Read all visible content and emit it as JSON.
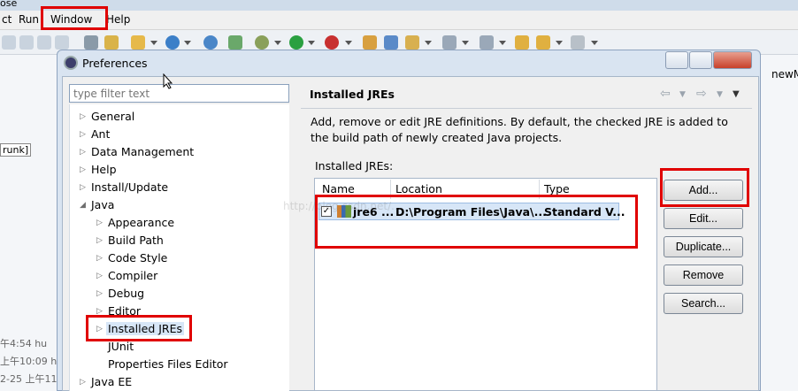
{
  "app": {
    "title_fragment": "ose",
    "menu": [
      "ct",
      "Run",
      "Window",
      "Help"
    ]
  },
  "dialog": {
    "title": "Preferences",
    "filter_placeholder": "type filter text",
    "tree": [
      {
        "label": "General",
        "level": 0,
        "expanded": false
      },
      {
        "label": "Ant",
        "level": 0,
        "expanded": false
      },
      {
        "label": "Data Management",
        "level": 0,
        "expanded": false
      },
      {
        "label": "Help",
        "level": 0,
        "expanded": false
      },
      {
        "label": "Install/Update",
        "level": 0,
        "expanded": false
      },
      {
        "label": "Java",
        "level": 0,
        "expanded": true
      },
      {
        "label": "Appearance",
        "level": 1,
        "expanded": false
      },
      {
        "label": "Build Path",
        "level": 1,
        "expanded": false
      },
      {
        "label": "Code Style",
        "level": 1,
        "expanded": false
      },
      {
        "label": "Compiler",
        "level": 1,
        "expanded": false
      },
      {
        "label": "Debug",
        "level": 1,
        "expanded": false
      },
      {
        "label": "Editor",
        "level": 1,
        "expanded": false
      },
      {
        "label": "Installed JREs",
        "level": 1,
        "expanded": false,
        "selected": true
      },
      {
        "label": "JUnit",
        "level": 1,
        "leaf": true
      },
      {
        "label": "Properties Files Editor",
        "level": 1,
        "leaf": true
      },
      {
        "label": "Java EE",
        "level": 0,
        "expanded": false
      }
    ],
    "page": {
      "title": "Installed JREs",
      "description": "Add, remove or edit JRE definitions. By default, the checked JRE is added to the build path of newly created Java projects.",
      "table_label": "Installed JREs:",
      "columns": [
        "Name",
        "Location",
        "Type"
      ],
      "rows": [
        {
          "checked": true,
          "name": "jre6 ...",
          "location": "D:\\Program Files\\Java\\...",
          "type": "Standard V..."
        }
      ],
      "buttons": [
        "Add...",
        "Edit...",
        "Duplicate...",
        "Remove",
        "Search..."
      ]
    }
  },
  "background": {
    "left_texts": [
      "runk]",
      "午4:54  hu",
      "上午10:09  h",
      "2-25 上午11"
    ],
    "right_tab": "newM",
    "watermark": "http://blog.csdn.net/..."
  },
  "colors": {
    "highlight": "#e00000",
    "selection": "#d7e6f7"
  }
}
